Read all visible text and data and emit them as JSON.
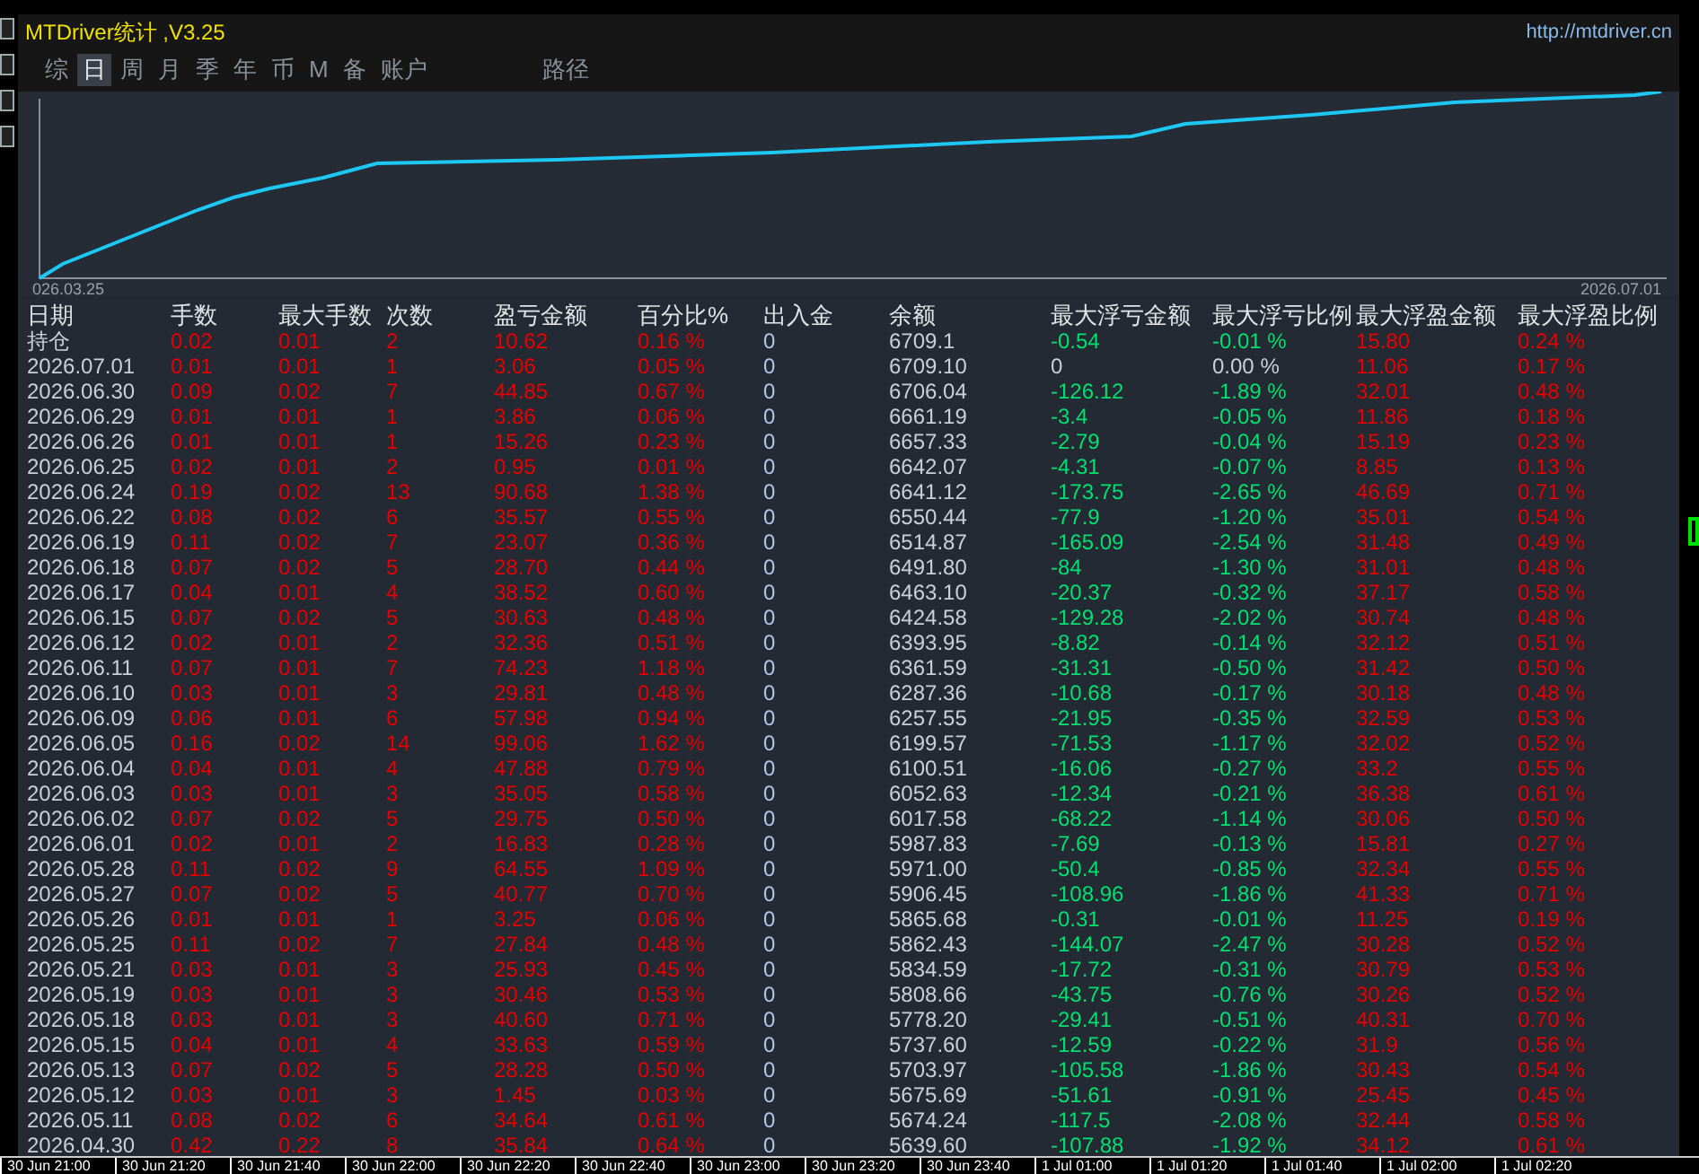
{
  "window": {
    "title": "MTDriver统计 ,V3.25",
    "url": "http://mtdriver.cn"
  },
  "tabs": [
    {
      "label": "综",
      "selected": false
    },
    {
      "label": "日",
      "selected": true
    },
    {
      "label": "周",
      "selected": false
    },
    {
      "label": "月",
      "selected": false
    },
    {
      "label": "季",
      "selected": false
    },
    {
      "label": "年",
      "selected": false
    },
    {
      "label": "币",
      "selected": false
    },
    {
      "label": "M",
      "selected": false
    },
    {
      "label": "备",
      "selected": false
    },
    {
      "label": "账户",
      "selected": false
    }
  ],
  "path_tab": {
    "label": "路径",
    "selected": false
  },
  "equity_chart": {
    "start_label": "026.03.25",
    "end_label": "2026.07.01"
  },
  "table": {
    "columns": [
      {
        "label": "日期",
        "color": "#c8d0d8"
      },
      {
        "label": "手数",
        "color": "#e60000"
      },
      {
        "label": "最大手数",
        "color": "#e60000"
      },
      {
        "label": "次数",
        "color": "#e60000"
      },
      {
        "label": "盈亏金额",
        "color": "#e60000"
      },
      {
        "label": "百分比%",
        "color": "#e60000"
      },
      {
        "label": "出入金",
        "color": "#b0c8e8"
      },
      {
        "label": "余额",
        "color": "#c8d0d8"
      },
      {
        "label": "最大浮亏金额",
        "color": "#00e070"
      },
      {
        "label": "最大浮亏比例",
        "color": "#00e070"
      },
      {
        "label": "最大浮盈金额",
        "color": "#e60000"
      },
      {
        "label": "最大浮盈比例",
        "color": "#e60000"
      }
    ],
    "rows": [
      {
        "no_drawdown": false,
        "cells": [
          "持仓",
          "0.02",
          "0.01",
          "2",
          "10.62",
          "0.16 %",
          "0",
          "6709.1",
          "-0.54",
          "-0.01 %",
          "15.80",
          "0.24 %"
        ]
      },
      {
        "no_drawdown": true,
        "cells": [
          "2026.07.01",
          "0.01",
          "0.01",
          "1",
          "3.06",
          "0.05 %",
          "0",
          "6709.10",
          "0",
          "0.00 %",
          "11.06",
          "0.17 %"
        ]
      },
      {
        "no_drawdown": false,
        "cells": [
          "2026.06.30",
          "0.09",
          "0.02",
          "7",
          "44.85",
          "0.67 %",
          "0",
          "6706.04",
          "-126.12",
          "-1.89 %",
          "32.01",
          "0.48 %"
        ]
      },
      {
        "no_drawdown": false,
        "cells": [
          "2026.06.29",
          "0.01",
          "0.01",
          "1",
          "3.86",
          "0.06 %",
          "0",
          "6661.19",
          "-3.4",
          "-0.05 %",
          "11.86",
          "0.18 %"
        ]
      },
      {
        "no_drawdown": false,
        "cells": [
          "2026.06.26",
          "0.01",
          "0.01",
          "1",
          "15.26",
          "0.23 %",
          "0",
          "6657.33",
          "-2.79",
          "-0.04 %",
          "15.19",
          "0.23 %"
        ]
      },
      {
        "no_drawdown": false,
        "cells": [
          "2026.06.25",
          "0.02",
          "0.01",
          "2",
          "0.95",
          "0.01 %",
          "0",
          "6642.07",
          "-4.31",
          "-0.07 %",
          "8.85",
          "0.13 %"
        ]
      },
      {
        "no_drawdown": false,
        "cells": [
          "2026.06.24",
          "0.19",
          "0.02",
          "13",
          "90.68",
          "1.38 %",
          "0",
          "6641.12",
          "-173.75",
          "-2.65 %",
          "46.69",
          "0.71 %"
        ]
      },
      {
        "no_drawdown": false,
        "cells": [
          "2026.06.22",
          "0.08",
          "0.02",
          "6",
          "35.57",
          "0.55 %",
          "0",
          "6550.44",
          "-77.9",
          "-1.20 %",
          "35.01",
          "0.54 %"
        ]
      },
      {
        "no_drawdown": false,
        "cells": [
          "2026.06.19",
          "0.11",
          "0.02",
          "7",
          "23.07",
          "0.36 %",
          "0",
          "6514.87",
          "-165.09",
          "-2.54 %",
          "31.48",
          "0.49 %"
        ]
      },
      {
        "no_drawdown": false,
        "cells": [
          "2026.06.18",
          "0.07",
          "0.02",
          "5",
          "28.70",
          "0.44 %",
          "0",
          "6491.80",
          "-84",
          "-1.30 %",
          "31.01",
          "0.48 %"
        ]
      },
      {
        "no_drawdown": false,
        "cells": [
          "2026.06.17",
          "0.04",
          "0.01",
          "4",
          "38.52",
          "0.60 %",
          "0",
          "6463.10",
          "-20.37",
          "-0.32 %",
          "37.17",
          "0.58 %"
        ]
      },
      {
        "no_drawdown": false,
        "cells": [
          "2026.06.15",
          "0.07",
          "0.02",
          "5",
          "30.63",
          "0.48 %",
          "0",
          "6424.58",
          "-129.28",
          "-2.02 %",
          "30.74",
          "0.48 %"
        ]
      },
      {
        "no_drawdown": false,
        "cells": [
          "2026.06.12",
          "0.02",
          "0.01",
          "2",
          "32.36",
          "0.51 %",
          "0",
          "6393.95",
          "-8.82",
          "-0.14 %",
          "32.12",
          "0.51 %"
        ]
      },
      {
        "no_drawdown": false,
        "cells": [
          "2026.06.11",
          "0.07",
          "0.01",
          "7",
          "74.23",
          "1.18 %",
          "0",
          "6361.59",
          "-31.31",
          "-0.50 %",
          "31.42",
          "0.50 %"
        ]
      },
      {
        "no_drawdown": false,
        "cells": [
          "2026.06.10",
          "0.03",
          "0.01",
          "3",
          "29.81",
          "0.48 %",
          "0",
          "6287.36",
          "-10.68",
          "-0.17 %",
          "30.18",
          "0.48 %"
        ]
      },
      {
        "no_drawdown": false,
        "cells": [
          "2026.06.09",
          "0.06",
          "0.01",
          "6",
          "57.98",
          "0.94 %",
          "0",
          "6257.55",
          "-21.95",
          "-0.35 %",
          "32.59",
          "0.53 %"
        ]
      },
      {
        "no_drawdown": false,
        "cells": [
          "2026.06.05",
          "0.16",
          "0.02",
          "14",
          "99.06",
          "1.62 %",
          "0",
          "6199.57",
          "-71.53",
          "-1.17 %",
          "32.02",
          "0.52 %"
        ]
      },
      {
        "no_drawdown": false,
        "cells": [
          "2026.06.04",
          "0.04",
          "0.01",
          "4",
          "47.88",
          "0.79 %",
          "0",
          "6100.51",
          "-16.06",
          "-0.27 %",
          "33.2",
          "0.55 %"
        ]
      },
      {
        "no_drawdown": false,
        "cells": [
          "2026.06.03",
          "0.03",
          "0.01",
          "3",
          "35.05",
          "0.58 %",
          "0",
          "6052.63",
          "-12.34",
          "-0.21 %",
          "36.38",
          "0.61 %"
        ]
      },
      {
        "no_drawdown": false,
        "cells": [
          "2026.06.02",
          "0.07",
          "0.02",
          "5",
          "29.75",
          "0.50 %",
          "0",
          "6017.58",
          "-68.22",
          "-1.14 %",
          "30.06",
          "0.50 %"
        ]
      },
      {
        "no_drawdown": false,
        "cells": [
          "2026.06.01",
          "0.02",
          "0.01",
          "2",
          "16.83",
          "0.28 %",
          "0",
          "5987.83",
          "-7.69",
          "-0.13 %",
          "15.81",
          "0.27 %"
        ]
      },
      {
        "no_drawdown": false,
        "cells": [
          "2026.05.28",
          "0.11",
          "0.02",
          "9",
          "64.55",
          "1.09 %",
          "0",
          "5971.00",
          "-50.4",
          "-0.85 %",
          "32.34",
          "0.55 %"
        ]
      },
      {
        "no_drawdown": false,
        "cells": [
          "2026.05.27",
          "0.07",
          "0.02",
          "5",
          "40.77",
          "0.70 %",
          "0",
          "5906.45",
          "-108.96",
          "-1.86 %",
          "41.33",
          "0.71 %"
        ]
      },
      {
        "no_drawdown": false,
        "cells": [
          "2026.05.26",
          "0.01",
          "0.01",
          "1",
          "3.25",
          "0.06 %",
          "0",
          "5865.68",
          "-0.31",
          "-0.01 %",
          "11.25",
          "0.19 %"
        ]
      },
      {
        "no_drawdown": false,
        "cells": [
          "2026.05.25",
          "0.11",
          "0.02",
          "7",
          "27.84",
          "0.48 %",
          "0",
          "5862.43",
          "-144.07",
          "-2.47 %",
          "30.28",
          "0.52 %"
        ]
      },
      {
        "no_drawdown": false,
        "cells": [
          "2026.05.21",
          "0.03",
          "0.01",
          "3",
          "25.93",
          "0.45 %",
          "0",
          "5834.59",
          "-17.72",
          "-0.31 %",
          "30.79",
          "0.53 %"
        ]
      },
      {
        "no_drawdown": false,
        "cells": [
          "2026.05.19",
          "0.03",
          "0.01",
          "3",
          "30.46",
          "0.53 %",
          "0",
          "5808.66",
          "-43.75",
          "-0.76 %",
          "30.26",
          "0.52 %"
        ]
      },
      {
        "no_drawdown": false,
        "cells": [
          "2026.05.18",
          "0.03",
          "0.01",
          "3",
          "40.60",
          "0.71 %",
          "0",
          "5778.20",
          "-29.41",
          "-0.51 %",
          "40.31",
          "0.70 %"
        ]
      },
      {
        "no_drawdown": false,
        "cells": [
          "2026.05.15",
          "0.04",
          "0.01",
          "4",
          "33.63",
          "0.59 %",
          "0",
          "5737.60",
          "-12.59",
          "-0.22 %",
          "31.9",
          "0.56 %"
        ]
      },
      {
        "no_drawdown": false,
        "cells": [
          "2026.05.13",
          "0.07",
          "0.02",
          "5",
          "28.28",
          "0.50 %",
          "0",
          "5703.97",
          "-105.58",
          "-1.86 %",
          "30.43",
          "0.54 %"
        ]
      },
      {
        "no_drawdown": false,
        "cells": [
          "2026.05.12",
          "0.03",
          "0.01",
          "3",
          "1.45",
          "0.03 %",
          "0",
          "5675.69",
          "-51.61",
          "-0.91 %",
          "25.45",
          "0.45 %"
        ]
      },
      {
        "no_drawdown": false,
        "cells": [
          "2026.05.11",
          "0.08",
          "0.02",
          "6",
          "34.64",
          "0.61 %",
          "0",
          "5674.24",
          "-117.5",
          "-2.08 %",
          "32.44",
          "0.58 %"
        ]
      },
      {
        "no_drawdown": false,
        "cells": [
          "2026.04.30",
          "0.42",
          "0.22",
          "8",
          "35.84",
          "0.64 %",
          "0",
          "5639.60",
          "-107.88",
          "-1.92 %",
          "34.12",
          "0.61 %"
        ]
      }
    ]
  },
  "time_axis": [
    "30 Jun 21:00",
    "30 Jun 21:20",
    "30 Jun 21:40",
    "30 Jun 22:00",
    "30 Jun 22:20",
    "30 Jun 22:40",
    "30 Jun 23:00",
    "30 Jun 23:20",
    "30 Jun 23:40",
    "1 Jul 01:00",
    "1 Jul 01:20",
    "1 Jul 01:40",
    "1 Jul 02:00",
    "1 Jul 02:20"
  ]
}
